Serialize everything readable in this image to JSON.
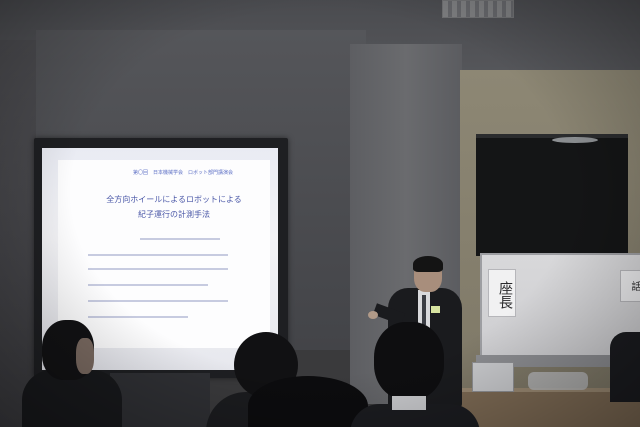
{
  "photo": {
    "slide": {
      "header": "第〇回　日本機械学会　ロボット部門講演会",
      "title_line1": "全方向ホイールによるロボットによる",
      "title_line2": "紀子運行の計測手法"
    },
    "chair_sign": "座長",
    "side_sign": "話"
  }
}
